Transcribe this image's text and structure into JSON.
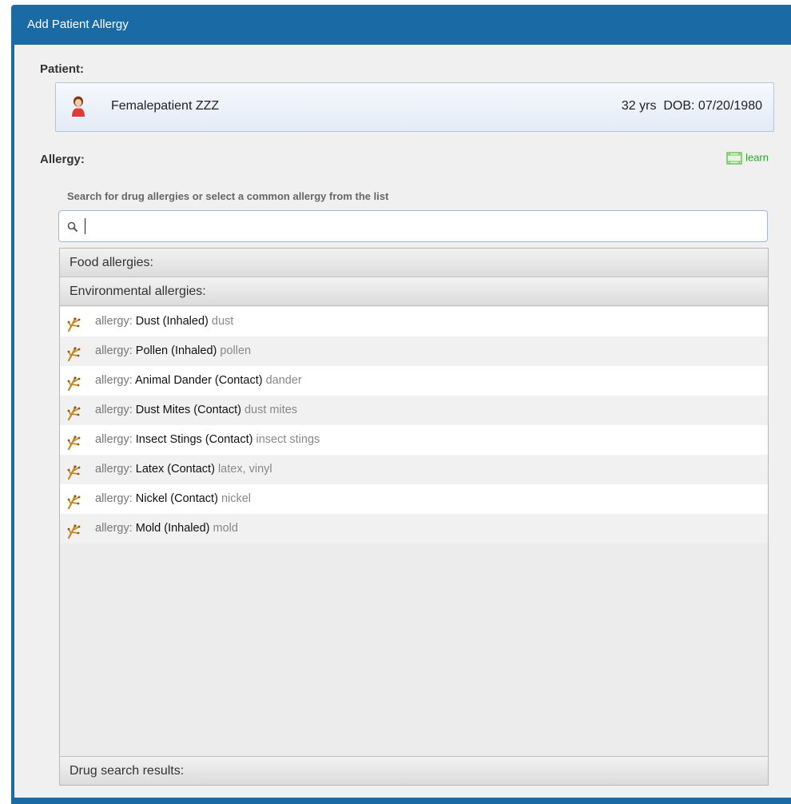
{
  "dialog": {
    "title": "Add Patient Allergy"
  },
  "patient": {
    "label": "Patient:",
    "name": "Femalepatient ZZZ",
    "age_dob": "32 yrs  DOB: 07/20/1980"
  },
  "allergy": {
    "label": "Allergy:",
    "learn_label": "learn",
    "hint": "Search for drug allergies or select a common allergy from the list",
    "search_value": "",
    "search_placeholder": ""
  },
  "groups": {
    "food": "Food allergies:",
    "environmental": "Environmental allergies:",
    "drug": "Drug search results:"
  },
  "items": [
    {
      "prefix": "allergy:",
      "name": "Dust (Inhaled)",
      "detail": "dust"
    },
    {
      "prefix": "allergy:",
      "name": "Pollen (Inhaled)",
      "detail": "pollen"
    },
    {
      "prefix": "allergy:",
      "name": "Animal Dander (Contact)",
      "detail": "dander"
    },
    {
      "prefix": "allergy:",
      "name": "Dust Mites  (Contact)",
      "detail": "dust mites"
    },
    {
      "prefix": "allergy:",
      "name": "Insect Stings  (Contact)",
      "detail": "insect stings"
    },
    {
      "prefix": "allergy:",
      "name": "Latex  (Contact)",
      "detail": "latex, vinyl"
    },
    {
      "prefix": "allergy:",
      "name": "Nickel  (Contact)",
      "detail": "nickel"
    },
    {
      "prefix": "allergy:",
      "name": "Mold (Inhaled)",
      "detail": "mold"
    }
  ],
  "colors": {
    "titlebar": "#1a6aa5",
    "learn": "#2ea32e"
  },
  "icons": {
    "patient": "female-patient-icon",
    "learn": "film-icon",
    "search": "search-icon",
    "allergy": "allergy-branch-icon"
  }
}
